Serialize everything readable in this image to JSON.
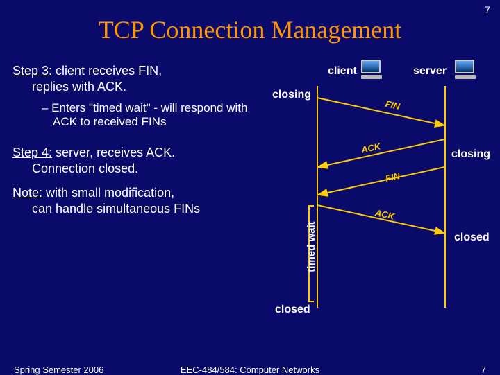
{
  "page_number_top": "7",
  "title": "TCP Connection Management",
  "steps": {
    "step3_label": "Step 3:",
    "step3_text": " client receives FIN,",
    "step3_body": "replies with ACK.",
    "step3_bullet": "– Enters \"timed wait\" - will respond with ACK to received FINs",
    "step4_label": "Step 4:",
    "step4_text": " server, receives ACK.",
    "step4_body": "Connection closed.",
    "note_label": "Note:",
    "note_text": " with small modification,",
    "note_body": "can handle simultaneous FINs"
  },
  "diagram": {
    "client_label": "client",
    "server_label": "server",
    "msg_fin1": "FIN",
    "msg_ack1": "ACK",
    "msg_fin2": "FIN",
    "msg_ack2": "ACK",
    "closing_left": "closing",
    "closing_right": "closing",
    "closed_left": "closed",
    "closed_right": "closed",
    "timed_wait": "timed wait"
  },
  "footer": {
    "left": "Spring Semester 2006",
    "center": "EEC-484/584: Computer Networks",
    "right": "7"
  },
  "colors": {
    "background": "#0a0a6b",
    "title": "#ff9500",
    "accent": "#ffcc00"
  }
}
